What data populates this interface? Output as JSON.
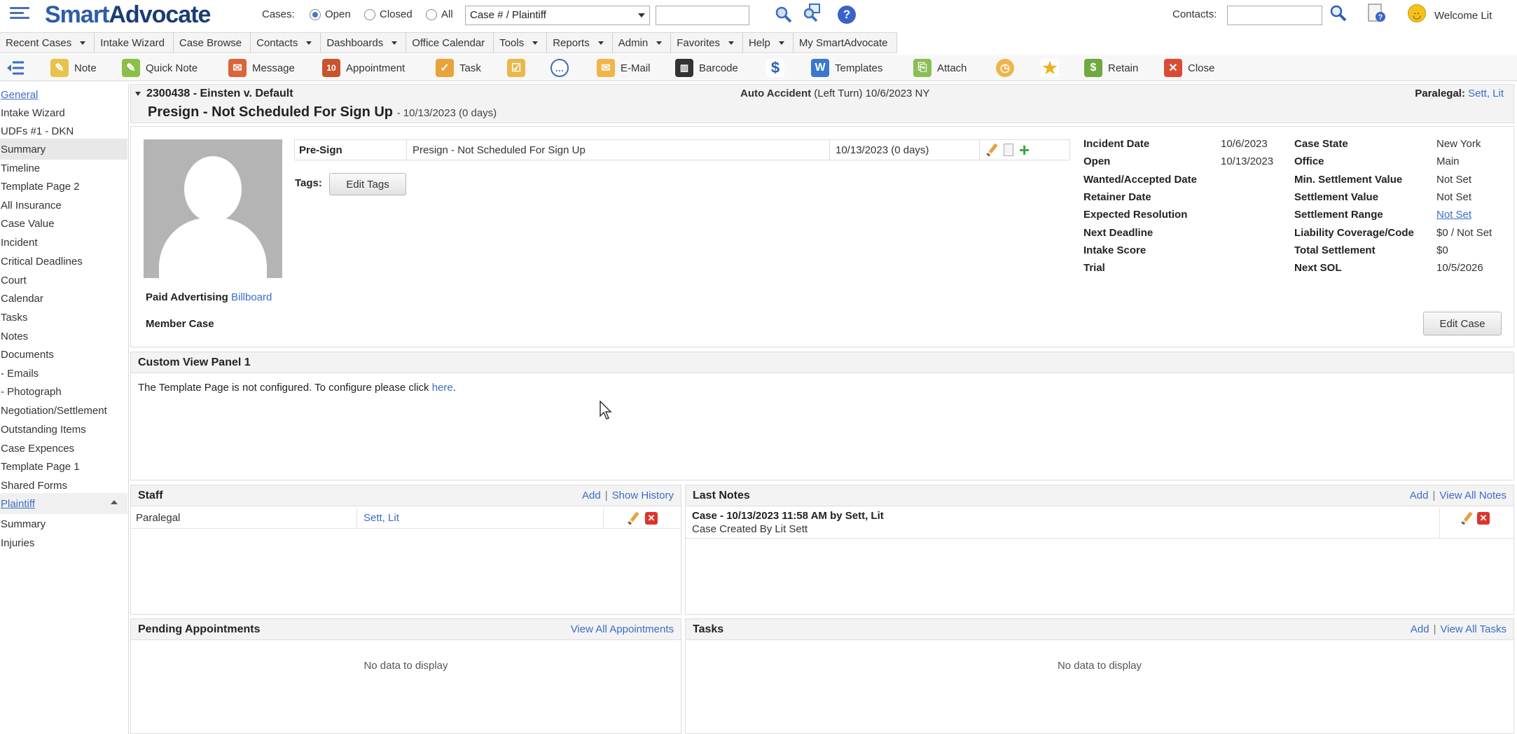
{
  "header": {
    "logo_smart": "Smart",
    "logo_advocate": "Advocate",
    "cases_label": "Cases:",
    "radio_open": "Open",
    "radio_closed": "Closed",
    "radio_all": "All",
    "case_select": "Case # / Plaintiff",
    "contacts_label": "Contacts:",
    "welcome": "Welcome Lit"
  },
  "menu": [
    {
      "label": "Recent Cases",
      "dropdown": true
    },
    {
      "label": "Intake Wizard",
      "dropdown": false
    },
    {
      "label": "Case Browse",
      "dropdown": false
    },
    {
      "label": "Contacts",
      "dropdown": true
    },
    {
      "label": "Dashboards",
      "dropdown": true
    },
    {
      "label": "Office Calendar",
      "dropdown": false
    },
    {
      "label": "Tools",
      "dropdown": true
    },
    {
      "label": "Reports",
      "dropdown": true
    },
    {
      "label": "Admin",
      "dropdown": true
    },
    {
      "label": "Favorites",
      "dropdown": true
    },
    {
      "label": "Help",
      "dropdown": true
    },
    {
      "label": "My SmartAdvocate",
      "dropdown": false
    }
  ],
  "toolbar": {
    "note": "Note",
    "quick_note": "Quick Note",
    "message": "Message",
    "appointment": "Appointment",
    "task": "Task",
    "email": "E-Mail",
    "barcode": "Barcode",
    "templates": "Templates",
    "attach": "Attach",
    "retain": "Retain",
    "close": "Close"
  },
  "sidebar": {
    "items": [
      "General",
      "Intake Wizard",
      "UDFs #1 - DKN",
      "Summary",
      "Timeline",
      "Template Page 2",
      "All Insurance",
      "Case Value",
      "Incident",
      "Critical Deadlines",
      "Court",
      "Calendar",
      "Tasks",
      "Notes",
      "Documents",
      " - Emails",
      " - Photograph",
      "Negotiation/Settlement",
      "Outstanding Items",
      "Case Expences",
      "Template Page 1",
      "Shared Forms",
      "Plaintiff",
      "Summary",
      "Injuries"
    ]
  },
  "case": {
    "id_line": "2300438 - Einsten v. Default",
    "status": "Presign - Not Scheduled For Sign Up",
    "status_sub": "- 10/13/2023 (0 days)",
    "type_bold": "Auto Accident",
    "type_rest": "(Left Turn) 10/6/2023 NY",
    "paralegal_label": "Paralegal:",
    "paralegal_name": "Sett, Lit"
  },
  "summary": {
    "presign_label": "Pre-Sign",
    "presign_status": "Presign - Not Scheduled For Sign Up",
    "presign_date": "10/13/2023 (0 days)",
    "tags_label": "Tags:",
    "edit_tags": "Edit Tags",
    "paid_label": "Paid Advertising",
    "paid_value": "Billboard",
    "member_case": "Member Case",
    "edit_case": "Edit Case",
    "left_fields": [
      {
        "k": "Incident Date",
        "v": "10/6/2023"
      },
      {
        "k": "Open",
        "v": "10/13/2023"
      },
      {
        "k": "Wanted/Accepted Date",
        "v": ""
      },
      {
        "k": "Retainer Date",
        "v": ""
      },
      {
        "k": "Expected Resolution",
        "v": ""
      },
      {
        "k": "Next Deadline",
        "v": ""
      },
      {
        "k": "Intake Score",
        "v": ""
      },
      {
        "k": "Trial",
        "v": ""
      }
    ],
    "right_fields": [
      {
        "k": "Case State",
        "v": "New York"
      },
      {
        "k": "Office",
        "v": "Main"
      },
      {
        "k": "Min. Settlement Value",
        "v": "Not Set"
      },
      {
        "k": "Settlement Value",
        "v": "Not Set"
      },
      {
        "k": "Settlement Range",
        "v": "Not Set"
      },
      {
        "k": "Liability Coverage/Code",
        "v": "$0 / Not Set"
      },
      {
        "k": "Total Settlement",
        "v": "$0"
      },
      {
        "k": "Next SOL",
        "v": "10/5/2026"
      }
    ]
  },
  "custom_panel": {
    "title": "Custom View Panel 1",
    "text": "The Template Page is not configured. To configure please click",
    "link": "here",
    "period": "."
  },
  "staff": {
    "title": "Staff",
    "add": "Add",
    "history": "Show History",
    "role": "Paralegal",
    "name": "Sett, Lit"
  },
  "last_notes": {
    "title": "Last Notes",
    "add": "Add",
    "view_all": "View All Notes",
    "note_title": "Case - 10/13/2023 11:58 AM by Sett, Lit",
    "note_body": "Case Created By Lit Sett"
  },
  "appointments": {
    "title": "Pending Appointments",
    "view_all": "View All Appointments",
    "empty": "No data to display"
  },
  "tasks": {
    "title": "Tasks",
    "add": "Add",
    "view_all": "View All Tasks",
    "empty": "No data to display"
  },
  "separator": "|"
}
